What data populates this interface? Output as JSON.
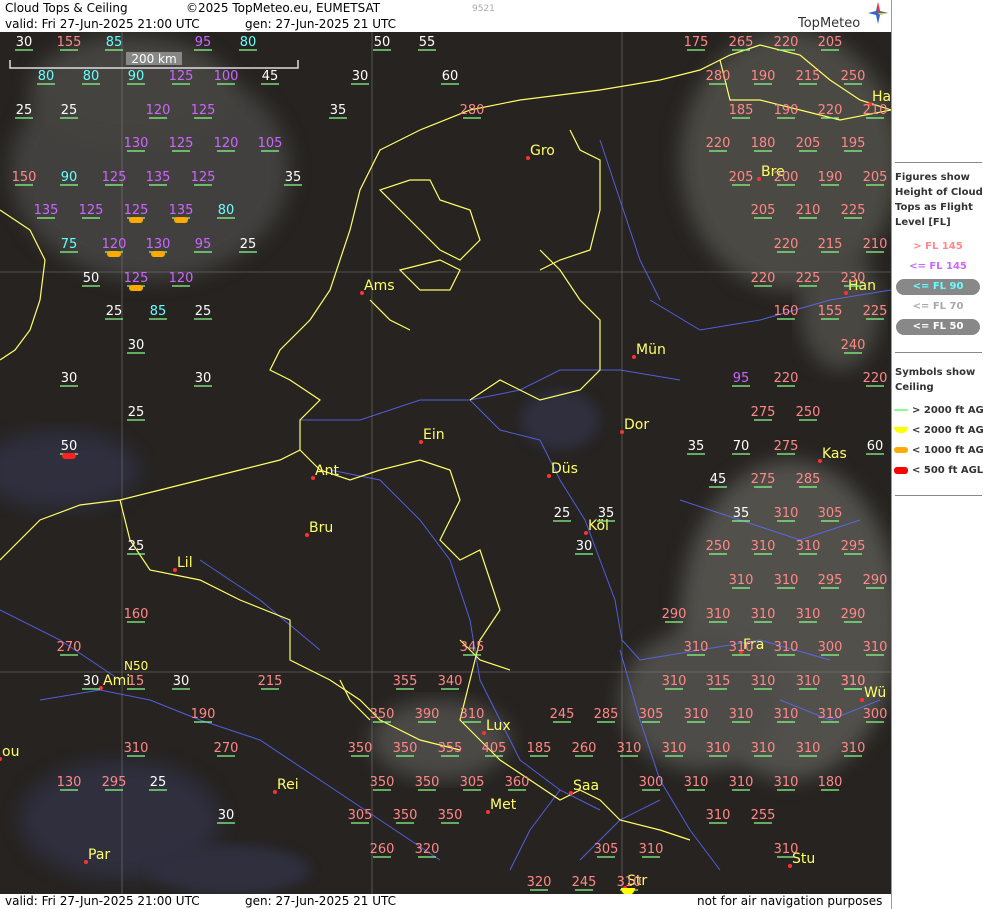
{
  "header": {
    "title": "Cloud Tops & Ceiling",
    "copyright": "©2025 TopMeteo.eu, EUMETSAT",
    "valid": "valid:  Fri  27-Jun-2025  21:00 UTC",
    "generated": "gen: 27-Jun-2025 21 UTC",
    "code": "9521",
    "brand": "TopMeteo"
  },
  "footer": {
    "valid": "valid:  Fri  27-Jun-2025  21:00 UTC",
    "generated": "gen: 27-Jun-2025 21 UTC",
    "disclaimer": "not for air navigation purposes"
  },
  "scale_label": "200 km",
  "lat_label": "N50",
  "legend": {
    "heading": "Figures show Height of Cloud Tops as Flight Level  [FL]",
    "items": [
      {
        "label": "> FL 145",
        "color": "#ff8888",
        "pill": false
      },
      {
        "label": "<= FL 145",
        "color": "#cc66ff",
        "pill": false
      },
      {
        "label": "<= FL 90",
        "color": "#66ffff",
        "pill": true
      },
      {
        "label": "<= FL 70",
        "color": "#aaaaaa",
        "pill": false
      },
      {
        "label": "<= FL 50",
        "color": "#ffffff",
        "pill": true
      }
    ],
    "ceiling_heading": "Symbols show Ceiling",
    "ceiling_items": [
      {
        "label": "> 2000 ft AGL",
        "color": "#88ff88"
      },
      {
        "label": "< 2000 ft AGL",
        "color": "#ffff00"
      },
      {
        "label": "< 1000 ft AGL",
        "color": "#ffaa00"
      },
      {
        "label": "< 500 ft AGL",
        "color": "#ff0000"
      }
    ]
  },
  "cities": [
    {
      "name": "Gro"
    },
    {
      "name": "Ams"
    },
    {
      "name": "Ein"
    },
    {
      "name": "Ant"
    },
    {
      "name": "Bru"
    },
    {
      "name": "Lil"
    },
    {
      "name": "Ami"
    },
    {
      "name": "Rei"
    },
    {
      "name": "Par"
    },
    {
      "name": "Lux"
    },
    {
      "name": "Met"
    },
    {
      "name": "Saa"
    },
    {
      "name": "Str"
    },
    {
      "name": "Stu"
    },
    {
      "name": "Wü"
    },
    {
      "name": "Fra"
    },
    {
      "name": "Köl"
    },
    {
      "name": "Düs"
    },
    {
      "name": "Dor"
    },
    {
      "name": "Mün"
    },
    {
      "name": "Kas"
    },
    {
      "name": "Han"
    },
    {
      "name": "Bre"
    },
    {
      "name": "Ha"
    },
    {
      "name": "ou"
    }
  ],
  "values": [
    "30",
    "155",
    "85",
    "95",
    "80",
    "50",
    "55",
    "175",
    "265",
    "220",
    "205",
    "80",
    "80",
    "90",
    "125",
    "100",
    "45",
    "30",
    "60",
    "280",
    "190",
    "215",
    "250",
    "25",
    "25",
    "120",
    "125",
    "35",
    "280",
    "185",
    "190",
    "220",
    "210",
    "130",
    "125",
    "120",
    "105",
    "220",
    "180",
    "205",
    "195",
    "150",
    "90",
    "125",
    "135",
    "125",
    "35",
    "205",
    "200",
    "190",
    "205",
    "135",
    "125",
    "125",
    "135",
    "80",
    "205",
    "210",
    "225",
    "75",
    "120",
    "130",
    "95",
    "25",
    "220",
    "215",
    "210",
    "50",
    "125",
    "120",
    "220",
    "225",
    "230",
    "25",
    "85",
    "25",
    "160",
    "155",
    "225",
    "30",
    "240",
    "30",
    "30",
    "95",
    "220",
    "220",
    "25",
    "275",
    "250",
    "50",
    "35",
    "70",
    "275",
    "60",
    "45",
    "275",
    "285",
    "25",
    "35",
    "35",
    "310",
    "305",
    "25",
    "30",
    "250",
    "310",
    "310",
    "295",
    "310",
    "310",
    "295",
    "290",
    "160",
    "290",
    "310",
    "310",
    "310",
    "290",
    "270",
    "345",
    "310",
    "310",
    "310",
    "300",
    "310",
    "30",
    "15",
    "30",
    "215",
    "355",
    "340",
    "310",
    "315",
    "310",
    "310",
    "310",
    "310",
    "190",
    "350",
    "390",
    "310",
    "245",
    "285",
    "305",
    "310",
    "310",
    "310",
    "310",
    "300",
    "310",
    "270",
    "350",
    "350",
    "355",
    "405",
    "185",
    "260",
    "310",
    "310",
    "310",
    "310",
    "310",
    "310",
    "130",
    "295",
    "25",
    "350",
    "350",
    "305",
    "360",
    "300",
    "310",
    "310",
    "310",
    "180",
    "30",
    "305",
    "350",
    "350",
    "310",
    "255",
    "260",
    "320",
    "305",
    "310",
    "310",
    "320",
    "245",
    "310"
  ]
}
